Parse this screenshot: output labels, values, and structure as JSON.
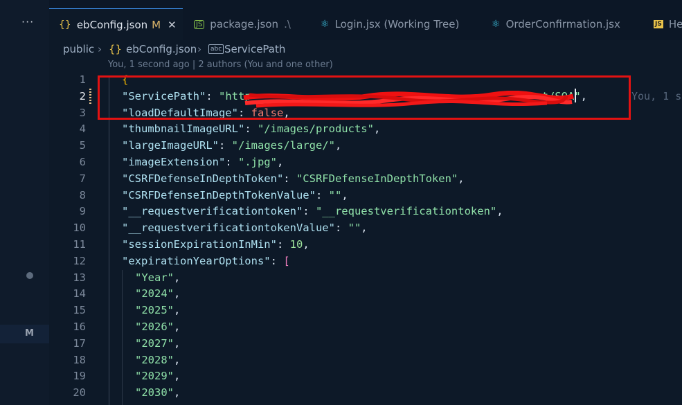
{
  "activity": {
    "more_icon": "ellipsis-icon",
    "badge": "M"
  },
  "tabs": [
    {
      "label": "ebConfig.json",
      "status": "M",
      "icon": "json-braces-icon"
    },
    {
      "label": "package.json",
      "suffix": ".\\",
      "icon": "nodejs-icon"
    },
    {
      "label": "Login.jsx (Working Tree)",
      "icon": "react-icon"
    },
    {
      "label": "OrderConfirmation.jsx",
      "icon": "react-icon"
    },
    {
      "label": "He",
      "icon": "js-file-icon"
    }
  ],
  "breadcrumb": {
    "folder": "public",
    "file": "ebConfig.json",
    "symbol": "ServicePath"
  },
  "blame": {
    "header": "You, 1 second ago | 2 authors (You and one other)",
    "inline": "You, 1 s"
  },
  "editor": {
    "lines": [
      "1",
      "2",
      "3",
      "4",
      "5",
      "6",
      "7",
      "8",
      "9",
      "10",
      "11",
      "12",
      "13",
      "14",
      "15",
      "16",
      "17",
      "18",
      "19",
      "20"
    ],
    "current_line": "2",
    "code": {
      "brace_open": "{",
      "service_key": "\"ServicePath\"",
      "service_value_start": "\"http",
      "service_value_end": "t/SOA\"",
      "load_key": "\"loadDefaultImage\"",
      "load_value": "false",
      "thumb_key": "\"thumbnailImageURL\"",
      "thumb_value": "\"/images/products\"",
      "large_key": "\"largeImageURL\"",
      "large_value": "\"/images/large/\"",
      "ext_key": "\"imageExtension\"",
      "ext_value": "\".jpg\"",
      "csrf_key": "\"CSRFDefenseInDepthToken\"",
      "csrf_value": "\"CSRFDefenseInDepthToken\"",
      "csrfv_key": "\"CSRFDefenseInDepthTokenValue\"",
      "csrfv_value": "\"\"",
      "rvt_key": "\"__requestverificationtoken\"",
      "rvt_value": "\"__requestverificationtoken\"",
      "rvtv_key": "\"__requestverificationtokenValue\"",
      "rvtv_value": "\"\"",
      "sess_key": "\"sessionExpirationInMin\"",
      "sess_value": "10",
      "exp_key": "\"expirationYearOptions\"",
      "bracket_open": "[",
      "years": [
        "\"Year\"",
        "\"2024\"",
        "\"2025\"",
        "\"2026\"",
        "\"2027\"",
        "\"2028\"",
        "\"2029\"",
        "\"2030\""
      ]
    }
  },
  "colors": {
    "annotation": "#e31212",
    "accent": "#3b8eea"
  }
}
